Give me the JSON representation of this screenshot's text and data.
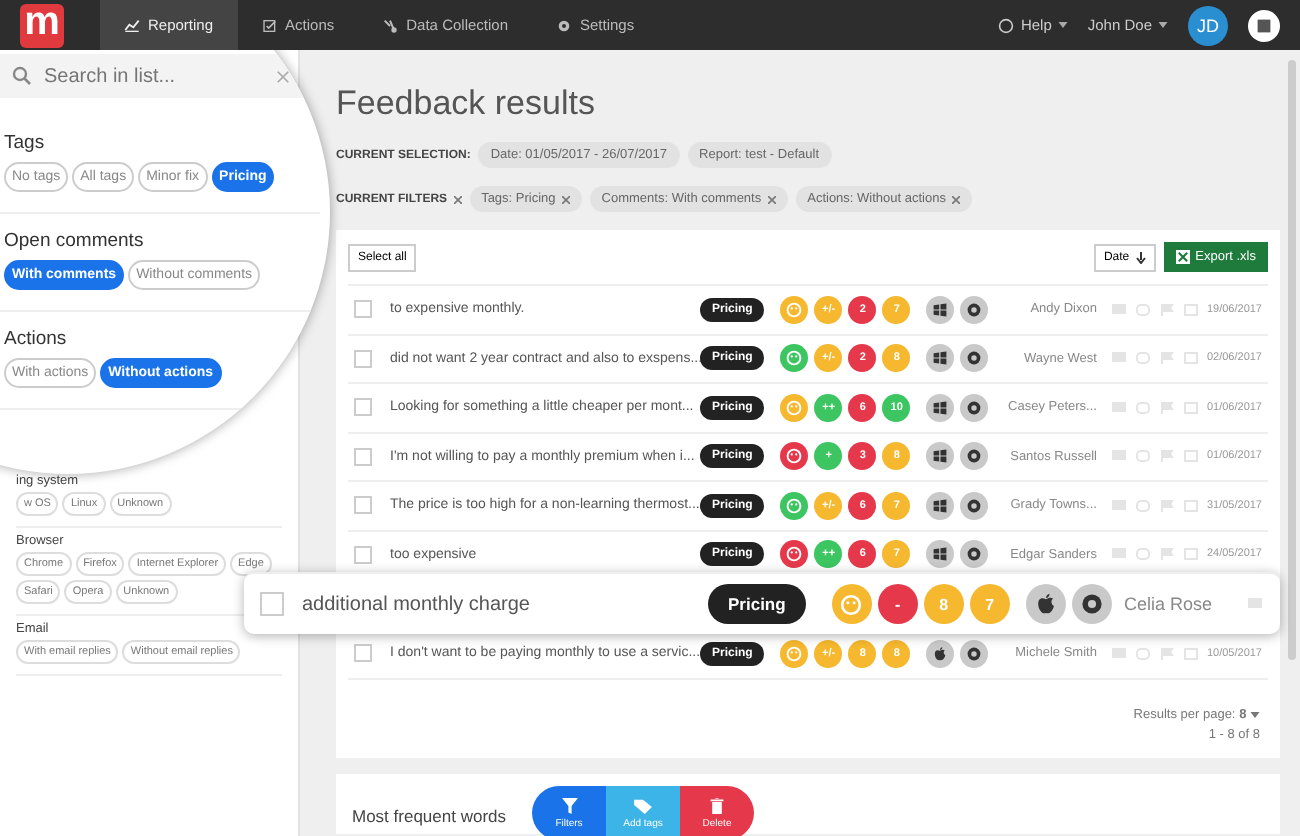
{
  "nav": {
    "logo": "m",
    "tabs": [
      {
        "label": "Reporting",
        "selected": true
      },
      {
        "label": "Actions",
        "selected": false
      },
      {
        "label": "Data Collection",
        "selected": false
      },
      {
        "label": "Settings",
        "selected": false
      }
    ],
    "help": "Help",
    "user": "John Doe",
    "avatar": "JD"
  },
  "magnifier": {
    "search": {
      "placeholder": "Search in list..."
    },
    "sections": [
      {
        "title": "Tags",
        "chips": [
          {
            "label": "No tags",
            "selected": false
          },
          {
            "label": "All tags",
            "selected": false
          },
          {
            "label": "Minor fix",
            "selected": false
          },
          {
            "label": "Pricing",
            "selected": true
          }
        ]
      },
      {
        "title": "Open comments",
        "chips": [
          {
            "label": "With comments",
            "selected": true
          },
          {
            "label": "Without comments",
            "selected": false
          }
        ]
      },
      {
        "title": "Actions",
        "chips": [
          {
            "label": "With actions",
            "selected": false
          },
          {
            "label": "Without actions",
            "selected": true
          }
        ]
      }
    ]
  },
  "sidebar": {
    "sections": [
      {
        "title": "ing system",
        "chips": [
          {
            "label": "w OS",
            "selected": false
          },
          {
            "label": "Linux",
            "selected": false
          },
          {
            "label": "Unknown",
            "selected": false
          }
        ]
      },
      {
        "title": "Browser",
        "chips": [
          {
            "label": "Chrome",
            "selected": false
          },
          {
            "label": "Firefox",
            "selected": false
          },
          {
            "label": "Internet Explorer",
            "selected": false
          },
          {
            "label": "Edge",
            "selected": false
          },
          {
            "label": "Safari",
            "selected": false
          },
          {
            "label": "Opera",
            "selected": false
          },
          {
            "label": "Unknown",
            "selected": false
          }
        ]
      },
      {
        "title": "Email",
        "chips": [
          {
            "label": "With email replies",
            "selected": false
          },
          {
            "label": "Without email replies",
            "selected": false
          }
        ]
      }
    ]
  },
  "main": {
    "title": "Feedback results",
    "selection_label": "CURRENT SELECTION:",
    "selection": [
      "Date: 01/05/2017 - 26/07/2017",
      "Report: test - Default"
    ],
    "filters_label": "CURRENT FILTERS",
    "filters": [
      "Tags: Pricing",
      "Comments: With comments",
      "Actions: Without actions"
    ],
    "select_all": "Select all",
    "sort": "Date",
    "export": "Export .xls",
    "rows": [
      {
        "text": "to expensive monthly.",
        "tag": "Pricing",
        "checked": false,
        "highlighted": false,
        "os": {
          "kind": "windows"
        },
        "name": "Andy Dixon",
        "date": "19/06/2017",
        "scores": [
          {
            "kind": "face",
            "color": "#f5b82e"
          },
          {
            "kind": "text",
            "text": "+/-",
            "color": "#f5b82e"
          },
          {
            "kind": "text",
            "text": "2",
            "color": "#e5394b"
          },
          {
            "kind": "text",
            "text": "7",
            "color": "#f5b82e"
          }
        ]
      },
      {
        "text": "did not want 2 year contract and also to exspens...",
        "tag": "Pricing",
        "checked": false,
        "highlighted": false,
        "os": {
          "kind": "windows"
        },
        "name": "Wayne West",
        "date": "02/06/2017",
        "scores": [
          {
            "kind": "face",
            "color": "#3cc561"
          },
          {
            "kind": "text",
            "text": "+/-",
            "color": "#f5b82e"
          },
          {
            "kind": "text",
            "text": "2",
            "color": "#e5394b"
          },
          {
            "kind": "text",
            "text": "8",
            "color": "#f5b82e"
          }
        ]
      },
      {
        "text": "Looking for something a little cheaper per mont...",
        "tag": "Pricing",
        "checked": false,
        "highlighted": false,
        "os": {
          "kind": "windows"
        },
        "name": "Casey Peters...",
        "date": "01/06/2017",
        "scores": [
          {
            "kind": "face",
            "color": "#f5b82e"
          },
          {
            "kind": "text",
            "text": "++",
            "color": "#3cc561"
          },
          {
            "kind": "text",
            "text": "6",
            "color": "#e5394b"
          },
          {
            "kind": "text",
            "text": "10",
            "color": "#3cc561"
          }
        ]
      },
      {
        "text": "I'm not willing to pay a monthly premium when i...",
        "tag": "Pricing",
        "checked": false,
        "highlighted": false,
        "os": {
          "kind": "windows"
        },
        "name": "Santos Russell",
        "date": "01/06/2017",
        "scores": [
          {
            "kind": "face",
            "color": "#e5394b"
          },
          {
            "kind": "text",
            "text": "+",
            "color": "#3cc561"
          },
          {
            "kind": "text",
            "text": "3",
            "color": "#e5394b"
          },
          {
            "kind": "text",
            "text": "8",
            "color": "#f5b82e"
          }
        ]
      },
      {
        "text": "The price is too high for a non-learning thermost...",
        "tag": "Pricing",
        "checked": false,
        "highlighted": false,
        "os": {
          "kind": "windows"
        },
        "name": "Grady Towns...",
        "date": "31/05/2017",
        "scores": [
          {
            "kind": "face",
            "color": "#3cc561"
          },
          {
            "kind": "text",
            "text": "+/-",
            "color": "#f5b82e"
          },
          {
            "kind": "text",
            "text": "6",
            "color": "#e5394b"
          },
          {
            "kind": "text",
            "text": "7",
            "color": "#f5b82e"
          }
        ]
      },
      {
        "text": "too expensive",
        "tag": "Pricing",
        "checked": false,
        "highlighted": false,
        "os": {
          "kind": "windows"
        },
        "name": "Edgar Sanders",
        "date": "24/05/2017",
        "scores": [
          {
            "kind": "face",
            "color": "#e5394b"
          },
          {
            "kind": "text",
            "text": "++",
            "color": "#3cc561"
          },
          {
            "kind": "text",
            "text": "6",
            "color": "#e5394b"
          },
          {
            "kind": "text",
            "text": "7",
            "color": "#f5b82e"
          }
        ]
      },
      {
        "text": "additional monthly charge",
        "tag": "Pricing",
        "checked": false,
        "highlighted": true,
        "os": {
          "kind": "apple"
        },
        "name": "Celia Rose",
        "scores": [
          {
            "kind": "face",
            "color": "#f5b82e"
          },
          {
            "kind": "text",
            "text": "-",
            "color": "#e5394b"
          },
          {
            "kind": "text",
            "text": "8",
            "color": "#f5b82e"
          },
          {
            "kind": "text",
            "text": "7",
            "color": "#f5b82e"
          }
        ]
      },
      {
        "text": "I don't want to be paying monthly to use a servic...",
        "tag": "Pricing",
        "checked": false,
        "highlighted": false,
        "os": {
          "kind": "apple"
        },
        "name": "Michele Smith",
        "date": "10/05/2017",
        "scores": [
          {
            "kind": "face",
            "color": "#f5b82e"
          },
          {
            "kind": "text",
            "text": "+/-",
            "color": "#f5b82e"
          },
          {
            "kind": "text",
            "text": "8",
            "color": "#f5b82e"
          },
          {
            "kind": "text",
            "text": "8",
            "color": "#f5b82e"
          }
        ]
      }
    ],
    "results_label": "Results per page:",
    "results_value": "8",
    "range": "1 - 8 of 8",
    "words_title": "Most frequent words",
    "actions": [
      {
        "kind": "filter",
        "label": "Filters"
      },
      {
        "kind": "tag",
        "label": "Add tags"
      },
      {
        "kind": "delete",
        "label": "Delete"
      }
    ]
  }
}
